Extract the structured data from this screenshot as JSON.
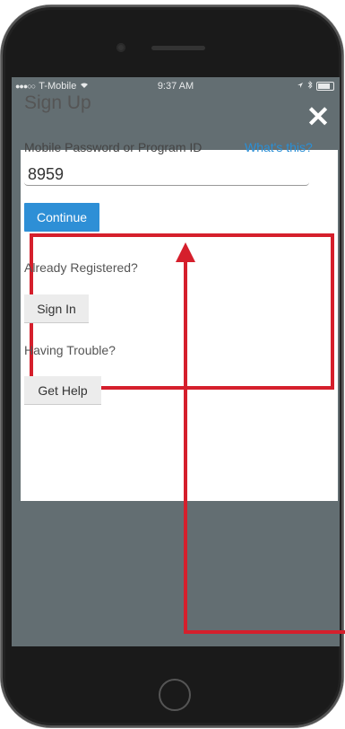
{
  "status_bar": {
    "carrier": "T-Mobile",
    "time": "9:37 AM",
    "signal_icon": "●●●○○",
    "wifi_icon": "wifi-icon",
    "location_icon": "location-arrow-icon",
    "battery_icon": "battery-icon"
  },
  "header": {
    "close_icon": "✕"
  },
  "signup": {
    "title": "Sign Up",
    "field_label": "Mobile Password or Program ID",
    "help_link": "What's this?",
    "input_value": "8959",
    "continue_label": "Continue"
  },
  "registered": {
    "prompt": "Already Registered?",
    "button_label": "Sign In"
  },
  "trouble": {
    "prompt": "Having Trouble?",
    "button_label": "Get Help"
  },
  "colors": {
    "highlight": "#d51f2c",
    "accent": "#2e8fd6",
    "background": "#636e72"
  }
}
